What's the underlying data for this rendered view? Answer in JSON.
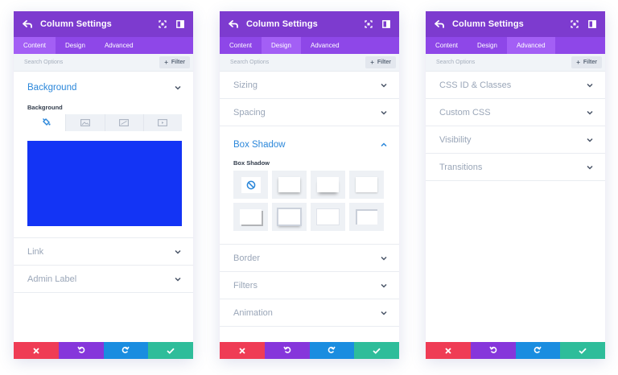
{
  "panels": [
    {
      "title": "Column Settings",
      "tabs": [
        "Content",
        "Design",
        "Advanced"
      ],
      "active_tab": "Content",
      "search_placeholder": "Search Options",
      "filter_label": "Filter",
      "open_section": {
        "label": "Background",
        "sublabel": "Background",
        "bg_tabs": [
          "color-icon",
          "image-icon",
          "gradient-icon",
          "video-icon"
        ],
        "color": "#1334f5"
      },
      "rows": [
        "Link",
        "Admin Label"
      ]
    },
    {
      "title": "Column Settings",
      "tabs": [
        "Content",
        "Design",
        "Advanced"
      ],
      "active_tab": "Design",
      "search_placeholder": "Search Options",
      "filter_label": "Filter",
      "rows_before": [
        "Sizing",
        "Spacing"
      ],
      "open_section": {
        "label": "Box Shadow",
        "sublabel": "Box Shadow",
        "presets": [
          "none",
          "preset-1",
          "preset-2",
          "preset-3",
          "preset-4",
          "preset-5",
          "preset-6",
          "preset-7"
        ]
      },
      "rows_after": [
        "Border",
        "Filters",
        "Animation"
      ]
    },
    {
      "title": "Column Settings",
      "tabs": [
        "Content",
        "Design",
        "Advanced"
      ],
      "active_tab": "Advanced",
      "search_placeholder": "Search Options",
      "filter_label": "Filter",
      "rows": [
        "CSS ID & Classes",
        "Custom CSS",
        "Visibility",
        "Transitions"
      ]
    }
  ],
  "footer_buttons": [
    {
      "name": "discard",
      "icon": "close-icon",
      "color": "#ef3c55"
    },
    {
      "name": "undo",
      "icon": "undo-icon",
      "color": "#8636db"
    },
    {
      "name": "redo",
      "icon": "redo-icon",
      "color": "#1a8de0"
    },
    {
      "name": "save",
      "icon": "check-icon",
      "color": "#2ebd9a"
    }
  ],
  "colors": {
    "titlebar": "#7d3bcf",
    "tabbar": "#8e47e8",
    "active_tab": "#a35ff5",
    "accent_blue": "#2b87da",
    "muted_text": "#9aa6b8"
  }
}
